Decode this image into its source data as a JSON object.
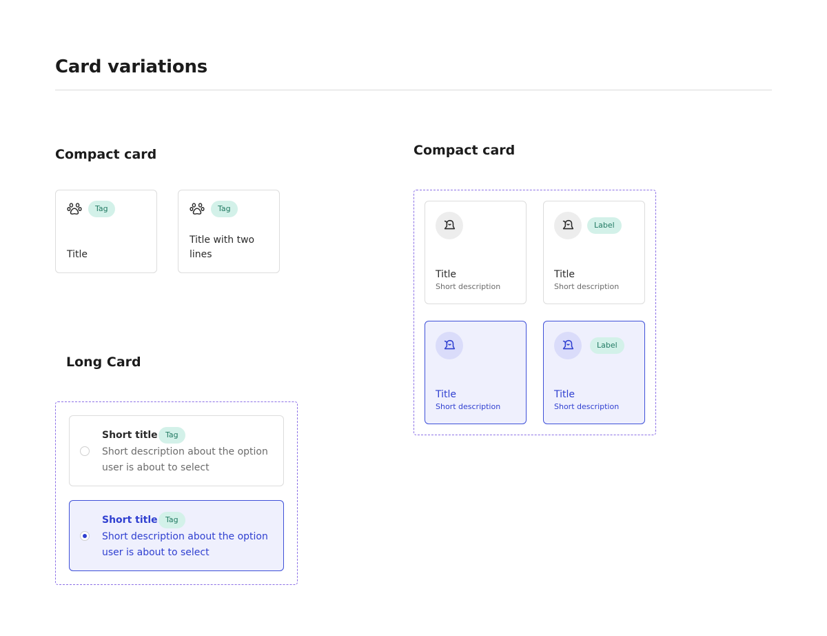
{
  "page": {
    "title": "Card variations"
  },
  "compact_section": {
    "heading": "Compact card",
    "cards": [
      {
        "icon": "paw-icon",
        "tag": "Tag",
        "title": "Title"
      },
      {
        "icon": "paw-icon",
        "tag": "Tag",
        "title": "Title with two lines"
      }
    ]
  },
  "grid_section": {
    "heading": "Compact card",
    "cards": [
      {
        "icon": "bell-icon",
        "label": "",
        "title": "Title",
        "description": "Short description",
        "selected": false
      },
      {
        "icon": "bell-icon",
        "label": "Label",
        "title": "Title",
        "description": "Short description",
        "selected": false
      },
      {
        "icon": "bell-icon",
        "label": "",
        "title": "Title",
        "description": "Short description",
        "selected": true
      },
      {
        "icon": "bell-icon",
        "label": "Label",
        "title": "Title",
        "description": "Short description",
        "selected": true
      }
    ]
  },
  "long_section": {
    "heading": "Long Card",
    "cards": [
      {
        "title": "Short title",
        "tag": "Tag",
        "description": "Short description about the option user is about to select",
        "selected": false
      },
      {
        "title": "Short title",
        "tag": "Tag",
        "description": "Short description about the option user is about to select",
        "selected": true
      }
    ]
  },
  "colors": {
    "accent": "#2f3fd0",
    "selected_bg": "#eff0fd",
    "tag_bg": "#d3f1e9",
    "tag_text": "#227a63",
    "frame_dash": "#8a6ee6",
    "border": "#dcdcdc"
  }
}
